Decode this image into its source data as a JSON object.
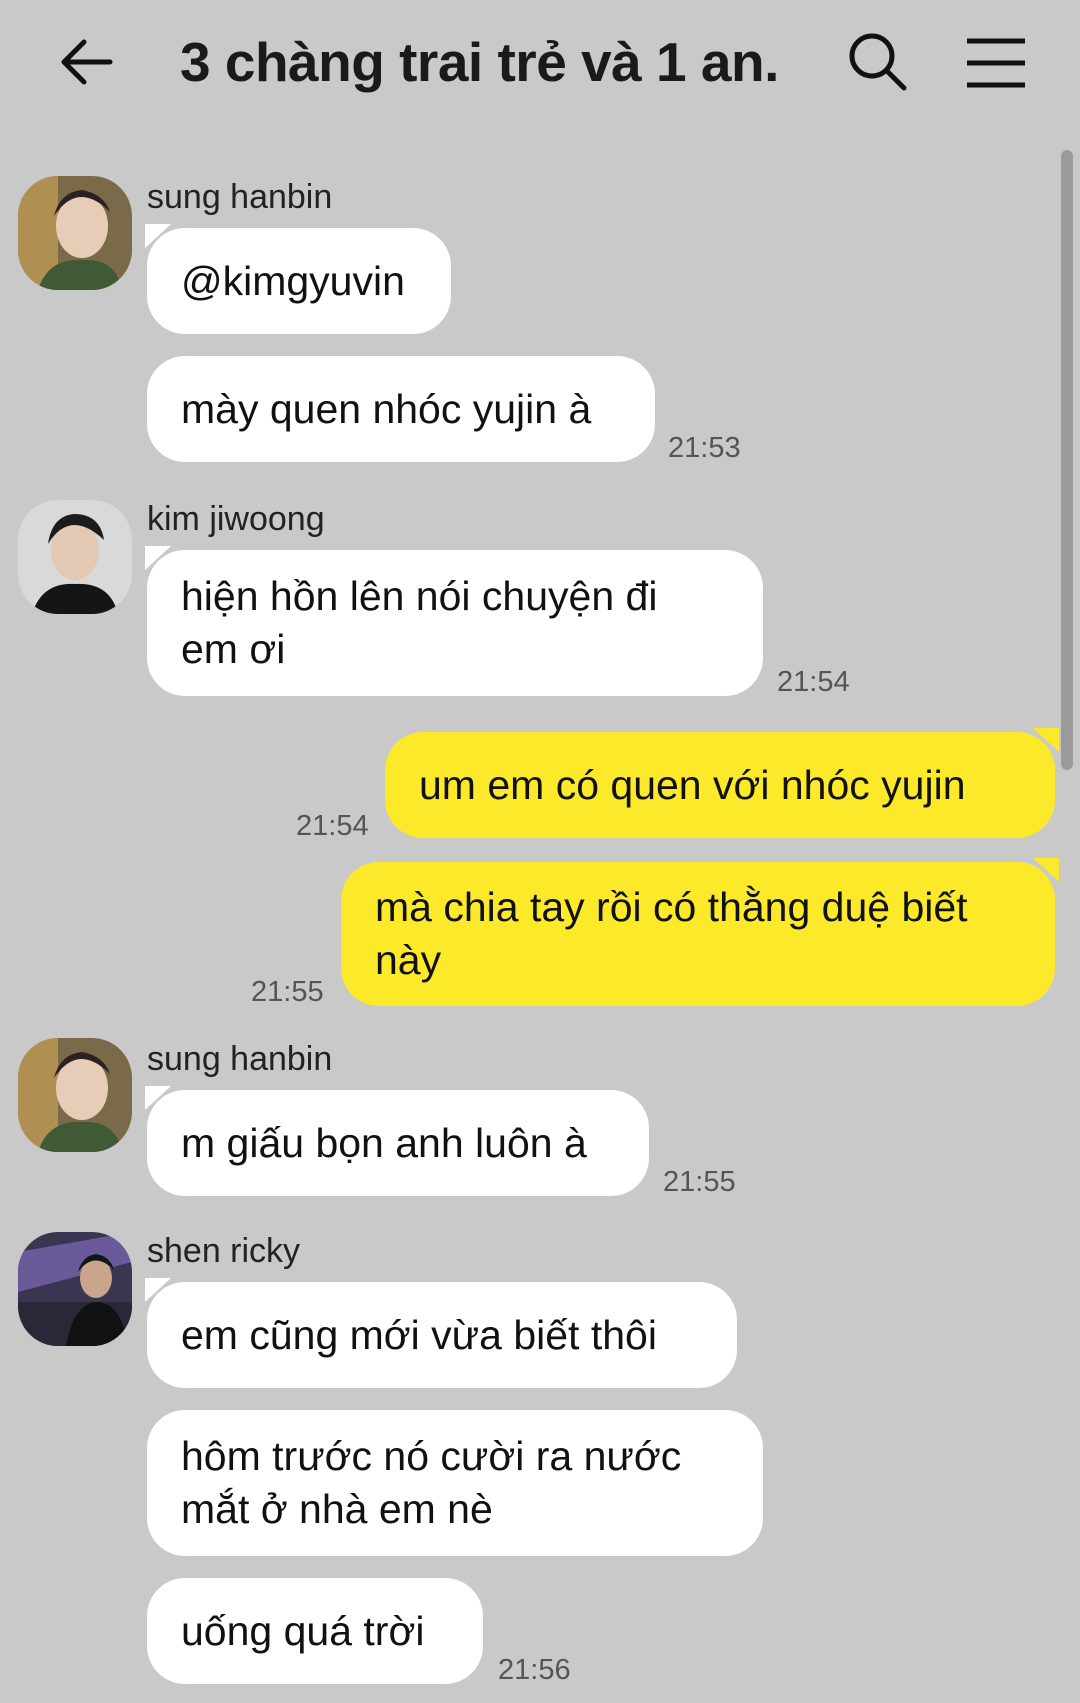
{
  "header": {
    "title": "3 chàng trai trẻ và 1 an...",
    "back_icon": "arrow-left-icon",
    "search_icon": "search-icon",
    "menu_icon": "hamburger-menu-icon"
  },
  "colors": {
    "background": "#c9c9c9",
    "incoming_bubble": "#ffffff",
    "outgoing_bubble": "#fcea2a"
  },
  "messages": [
    {
      "sender": "sung hanbin",
      "bubbles": [
        "@kimgyuvin",
        "mày quen nhóc yujin à"
      ],
      "time": "21:53"
    },
    {
      "sender": "kim jiwoong",
      "bubbles": [
        "hiện hồn lên nói chuyện đi em ơi"
      ],
      "time": "21:54"
    },
    {
      "sender": "me",
      "bubbles": [
        "um em có quen với nhóc yujin"
      ],
      "time": "21:54"
    },
    {
      "sender": "me",
      "bubbles": [
        "mà chia tay rồi có thằng duệ biết này"
      ],
      "time": "21:55"
    },
    {
      "sender": "sung hanbin",
      "bubbles": [
        "m giấu bọn anh luôn à"
      ],
      "time": "21:55"
    },
    {
      "sender": "shen ricky",
      "bubbles": [
        "em cũng mới vừa biết thôi",
        "hôm trước nó cười ra nước mắt ở nhà em nè",
        "uống quá trời"
      ],
      "time": "21:56"
    }
  ]
}
